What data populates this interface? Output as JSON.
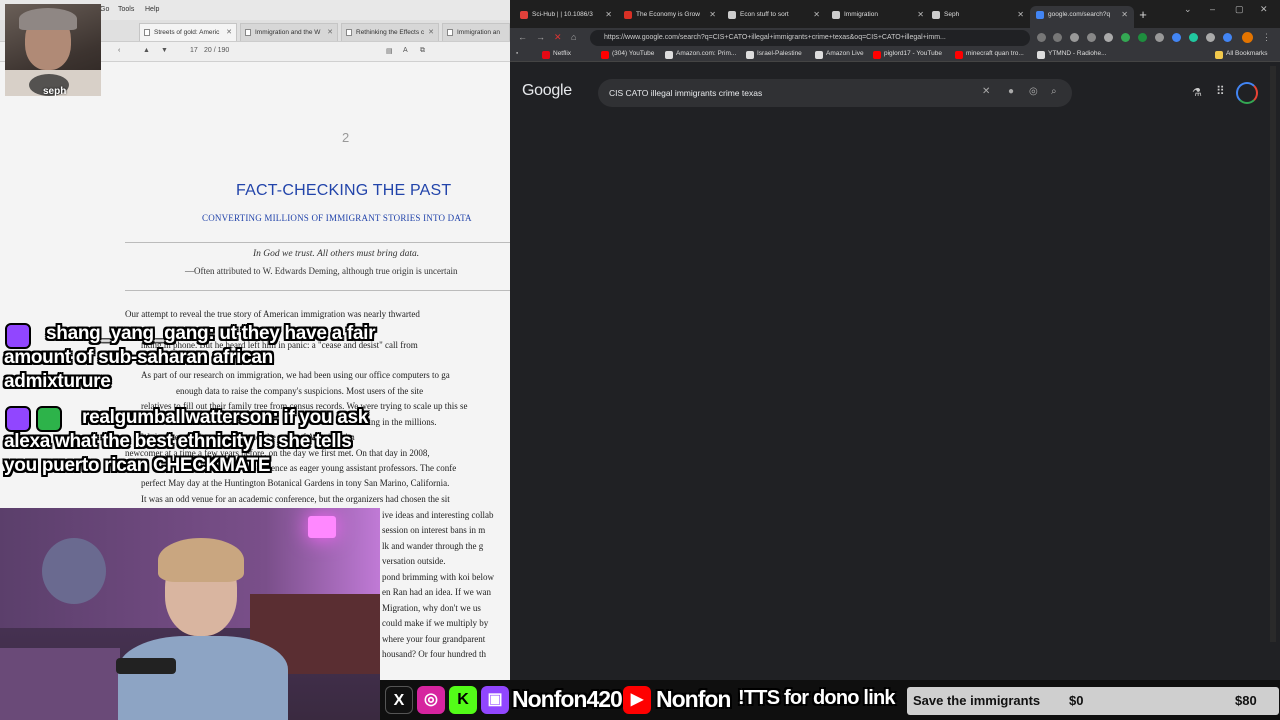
{
  "doc_viewer": {
    "menu": [
      "Go",
      "Tools",
      "Help"
    ],
    "tabs": [
      {
        "label": "Streets of gold: Americ",
        "active": true
      },
      {
        "label": "Immigration and the W",
        "active": false
      },
      {
        "label": "Rethinking the Effects c",
        "active": false
      },
      {
        "label": "Immigration an",
        "active": false
      }
    ],
    "page_field": "17",
    "page_count": "20 / 190",
    "chapter_number": "2",
    "chapter_title": "FACT-CHECKING THE PAST",
    "chapter_subtitle": "CONVERTING MILLIONS OF IMMIGRANT STORIES INTO DATA",
    "epigraph": "In God we trust. All others must bring data.",
    "attribution": "—Often attributed to W. Edwards Deming, although true origin is uncertain",
    "body_lines": [
      "Our attempt to reveal the true story of American immigration was nearly thwarted",
      "nking in phone. But he heard left him in panic: a \"cease and desist\" call from",
      "As part of our research on immigration, we had been using our office computers to ga",
      "enough data to raise the company's suspicions. Most users of the site",
      "relatives to fill out their family tree from census records. We were trying to scale up this se",
      "numbering in the millions.",
      "We had been trying to reconstruct the story of American im",
      "newcomer at a time a few years before, on the day we first met. On that day in 2008,",
      "conference as eager young assistant professors. The confe",
      "perfect May day at the Huntington Botanical Gardens in tony San Marino, California.",
      "It was an odd venue for an academic conference, but the organizers had chosen the sit",
      "ive ideas and interesting collab",
      "session on interest bans in m",
      "lk and wander through the g",
      "versation outside.",
      "pond brimming with koi below",
      "en Ran had an idea. If we wan",
      "Migration, why don't we us",
      "could make if we multiply by",
      "where your four grandparent",
      "housand? Or four hundred th"
    ]
  },
  "streamer": {
    "name": "seph"
  },
  "chat": [
    {
      "user": "shang_yang_gang:",
      "message": "ut they have a fair amount of sub-saharan african admixturure"
    },
    {
      "user": "realgumballwatterson:",
      "message": "if you ask alexa what the best ethnicity is she tells you puerto rican CHECKMATE"
    }
  ],
  "browser": {
    "tabs": [
      {
        "label": "Sci-Hub | | 10.1086/3",
        "favicon_color": "#e0403a",
        "active": false
      },
      {
        "label": "The Economy is Grow",
        "favicon_color": "#d93025",
        "active": false
      },
      {
        "label": "Econ stuff to sort",
        "favicon_color": "#cccccc",
        "active": false
      },
      {
        "label": "Immigration",
        "favicon_color": "#cccccc",
        "active": false
      },
      {
        "label": "Seph",
        "favicon_color": "#cccccc",
        "active": false
      },
      {
        "label": "google.com/search?q",
        "favicon_color": "#4285f4",
        "active": true
      }
    ],
    "url": "https://www.google.com/search?q=CIS+CATO+illegal+immigrants+crime+texas&oq=CIS+CATO+illegal+imm...",
    "bookmarks": [
      {
        "label": "Netflix",
        "color": "#e50914"
      },
      {
        "label": "(304) YouTube",
        "color": "#ff0000"
      },
      {
        "label": "Amazon.com: Prim...",
        "color": "#ffffff"
      },
      {
        "label": "Israel-Palestine",
        "color": "#ffffff"
      },
      {
        "label": "Amazon Live",
        "color": "#ffffff"
      },
      {
        "label": "piglord17 - YouTube",
        "color": "#ff0000"
      },
      {
        "label": "minecraft quan tro...",
        "color": "#ff0000"
      },
      {
        "label": "YTMND - Radiohe...",
        "color": "#ffffff"
      }
    ],
    "all_bookmarks": "All Bookmarks"
  },
  "google": {
    "logo": "Google",
    "query": "CIS CATO illegal immigrants crime texas"
  },
  "bottom_bar": {
    "handle_twitch": "Nonfon420",
    "handle_youtube": "Nonfon",
    "tts_text": "!TTS for dono link",
    "goal_title": "Save the immigrants",
    "goal_current": "$0",
    "goal_target": "$80",
    "goal_progress": 0
  }
}
